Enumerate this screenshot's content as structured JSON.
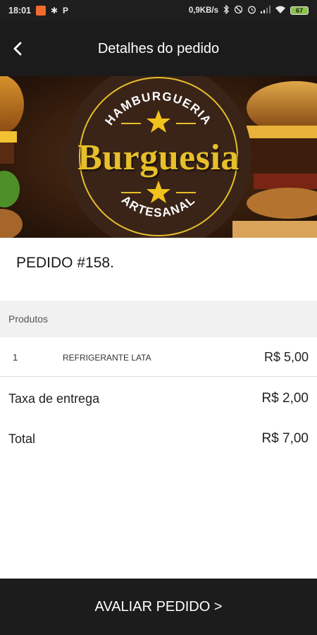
{
  "status_bar": {
    "time": "18:01",
    "notif_glyph_1": "✱",
    "notif_glyph_2": "P",
    "net_speed": "0,9KB/s",
    "battery_level": "67"
  },
  "app_bar": {
    "title": "Detalhes do pedido",
    "back_icon": "chevron-left-icon"
  },
  "banner": {
    "top_text": "HAMBURGUERIA",
    "brand": "Burguesia",
    "bottom_text": "ARTESANAL",
    "colors": {
      "gold": "#e7bf2a",
      "badge": "#3a2418"
    }
  },
  "order": {
    "number_label": "PEDIDO #158."
  },
  "products": {
    "header": "Produtos",
    "items": [
      {
        "qty": "1",
        "name": "REFRIGERANTE LATA",
        "price": "R$ 5,00"
      }
    ]
  },
  "summary": {
    "delivery_label": "Taxa de entrega",
    "delivery_value": "R$ 2,00",
    "total_label": "Total",
    "total_value": "R$ 7,00"
  },
  "action": {
    "rate_label": "AVALIAR PEDIDO >"
  }
}
